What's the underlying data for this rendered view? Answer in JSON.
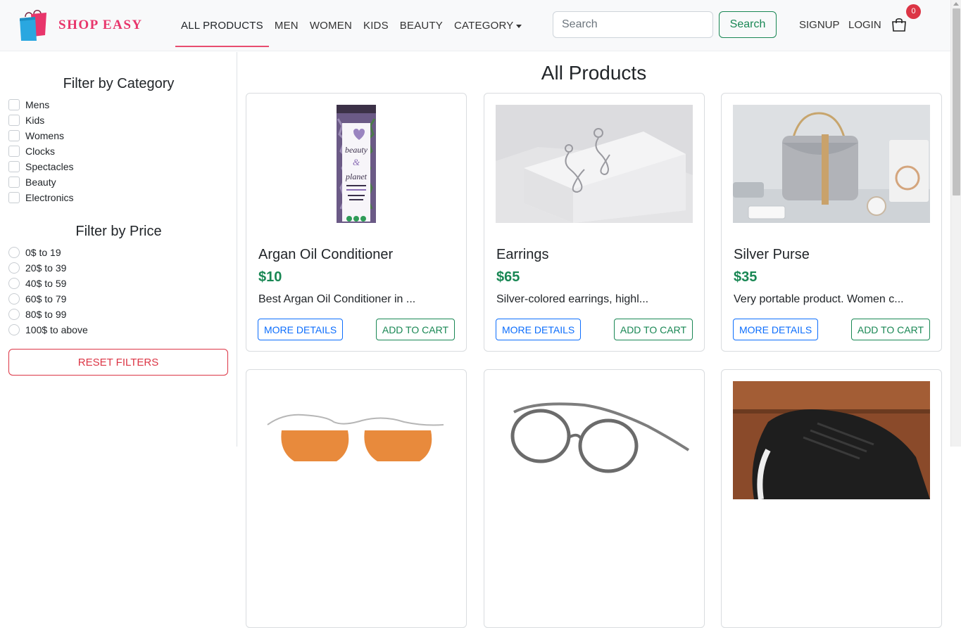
{
  "brand": {
    "name": "SHOP EASY"
  },
  "nav": {
    "items": [
      {
        "label": "ALL PRODUCTS"
      },
      {
        "label": "MEN"
      },
      {
        "label": "WOMEN"
      },
      {
        "label": "KIDS"
      },
      {
        "label": "BEAUTY"
      },
      {
        "label": "CATEGORY"
      }
    ]
  },
  "search": {
    "placeholder": "Search",
    "button_label": "Search"
  },
  "auth": {
    "signup_label": "SIGNUP",
    "login_label": "LOGIN"
  },
  "cart": {
    "count": "0",
    "icon": "shopping-bag-icon"
  },
  "sidebar": {
    "category_title": "Filter by Category",
    "categories": [
      "Mens",
      "Kids",
      "Womens",
      "Clocks",
      "Spectacles",
      "Beauty",
      "Electronics"
    ],
    "price_title": "Filter by Price",
    "prices": [
      "0$ to 19",
      "20$ to 39",
      "40$ to 59",
      "60$ to 79",
      "80$ to 99",
      "100$ to above"
    ],
    "reset_label": "RESET FILTERS"
  },
  "main": {
    "title": "All Products",
    "products": [
      {
        "title": "Argan Oil Conditioner",
        "price": "$10",
        "desc": "Best Argan Oil Conditioner in ...",
        "details_label": "MORE DETAILS",
        "cart_label": "ADD TO CART",
        "bottle_text_1": "beauty",
        "bottle_text_2": "&",
        "bottle_text_3": "planet"
      },
      {
        "title": "Earrings",
        "price": "$65",
        "desc": "Silver-colored earrings, highl...",
        "details_label": "MORE DETAILS",
        "cart_label": "ADD TO CART"
      },
      {
        "title": "Silver Purse",
        "price": "$35",
        "desc": "Very portable product. Women c...",
        "details_label": "MORE DETAILS",
        "cart_label": "ADD TO CART"
      }
    ]
  },
  "colors": {
    "brand": "#e8356b",
    "primary": "#0d6efd",
    "success": "#198754",
    "danger": "#dc3545"
  }
}
